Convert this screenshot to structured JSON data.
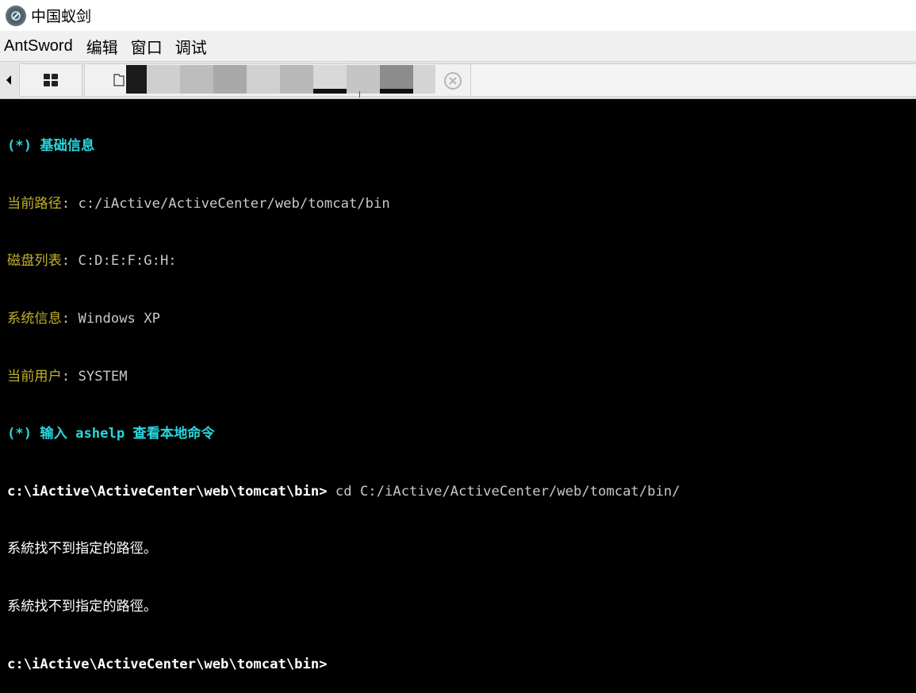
{
  "window": {
    "title": "中国蚁剑"
  },
  "menu": {
    "items": [
      "AntSword",
      "编辑",
      "窗口",
      "调试"
    ]
  },
  "tabs": {
    "file_tab_label": "",
    "blur_colors": [
      "#1a1a1a",
      "#cfcfcf",
      "#bdbdbd",
      "#a9a9a9",
      "#d0d0d0",
      "#b8b8b8",
      "#d9d9d9",
      "#111111",
      "#c5c5c5",
      "#8c8c8c",
      "#d4d4d4"
    ]
  },
  "terminal": {
    "header": "(*) 基础信息",
    "info": [
      {
        "key": "当前路径",
        "value": "c:/iActive/ActiveCenter/web/tomcat/bin"
      },
      {
        "key": "磁盘列表",
        "value": "C:D:E:F:G:H:"
      },
      {
        "key": "系统信息",
        "value": "Windows XP"
      },
      {
        "key": "当前用户",
        "value": "SYSTEM"
      }
    ],
    "help_hint": "(*) 输入 ashelp 查看本地命令",
    "prompt": "c:\\iActive\\ActiveCenter\\web\\tomcat\\bin>",
    "command": " cd C:/iActive/ActiveCenter/web/tomcat/bin/",
    "output": [
      "系統找不到指定的路徑。",
      "系統找不到指定的路徑。"
    ],
    "prompt2": "c:\\iActive\\ActiveCenter\\web\\tomcat\\bin>"
  },
  "colors": {
    "header": "#29d6de",
    "key": "#c2b12a",
    "value": "#c8c8c8",
    "prompt": "#ffffff"
  },
  "icons": {
    "app": "antsword-logo-icon",
    "home": "grid-icon",
    "folder": "folder-icon",
    "close": "close-circle-icon",
    "scroll": "caret-left-icon"
  }
}
